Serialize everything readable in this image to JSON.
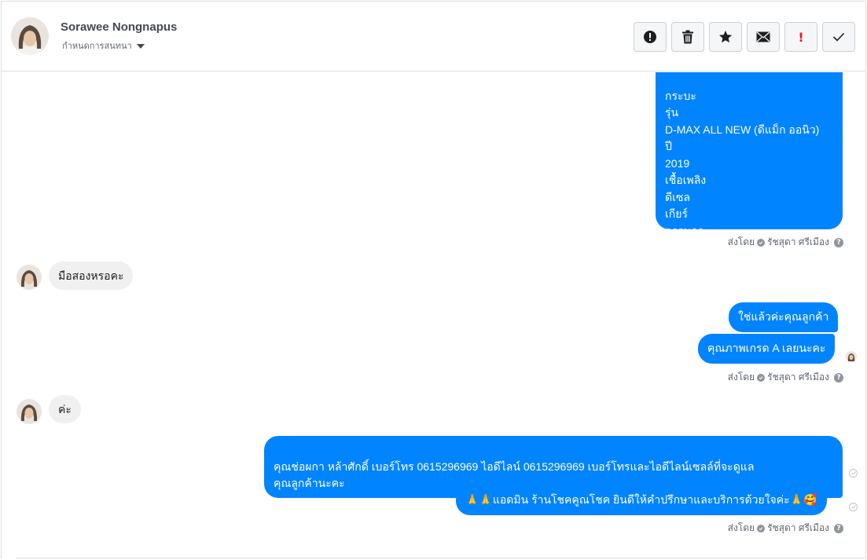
{
  "contact": {
    "name": "Sorawee Nongnapus",
    "assign_label": "กำหนดการสนทนา"
  },
  "toolbar": {
    "buttons": [
      {
        "name": "spam",
        "icon": "alert-circle-icon"
      },
      {
        "name": "delete",
        "icon": "trash-icon"
      },
      {
        "name": "star",
        "icon": "star-icon"
      },
      {
        "name": "mark-unread",
        "icon": "envelope-icon"
      },
      {
        "name": "follow-up",
        "icon": "exclamation-icon",
        "label": "!"
      },
      {
        "name": "done",
        "icon": "checkmark-icon"
      }
    ]
  },
  "messages": {
    "m1_text": "กระบะ\nรุ่น\nD-MAX ALL NEW (ดีแม็ก ออนิว)\nปี\n2019\nเชื้อเพลิง\nดีเซล\nเกียร์\nธรรมดา",
    "m2_text": "มือสองหรอคะ",
    "m3_text": "ใช่แล้วค่ะคุณลูกค้า",
    "m4_text": "คุณภาพเกรด A เลยนะคะ",
    "m5_text": "ค่ะ",
    "m6_text": "คุณช่อผกา หล้าศักดิ์      เบอร์โทร 0615296969  ไอดีไลน์ 0615296969  เบอร์โทรและไอดีไลน์เซลล์ที่จะดูแล\nคุณลูกค้านะคะ",
    "m7_text": "🙏🙏แอดมิน ร้านโชคคูณโชค ยินดีให้คำปรึกษาและบริการด้วยใจค่ะ🙏🥰"
  },
  "sent_by": {
    "prefix": "ส่งโดย",
    "agent": "รัชสุดา ศรีเมือง",
    "help": "?"
  },
  "colors": {
    "outgoing_bubble": "#0084ff",
    "incoming_bubble": "#f1f0f0"
  }
}
